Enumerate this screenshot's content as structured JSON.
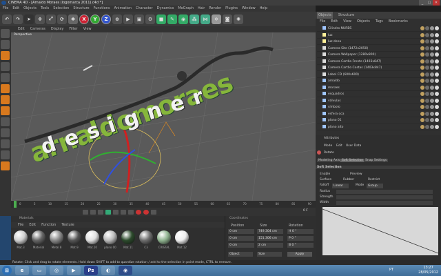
{
  "window": {
    "title": "CINEMA 4D - [Arnaldo Moraes (logomarca 2011).c4d *]",
    "buttons": [
      "_",
      "▢",
      "✕"
    ]
  },
  "menubar": [
    "File",
    "Edit",
    "Objects",
    "Tools",
    "Selection",
    "Structure",
    "Functions",
    "Animation",
    "Character",
    "Dynamics",
    "MoGraph",
    "Hair",
    "Render",
    "Plugins",
    "Window",
    "Help"
  ],
  "toolbar": {
    "axis_labels": [
      "X",
      "Y",
      "Z"
    ]
  },
  "viewport": {
    "menu": [
      "Edit",
      "Cameras",
      "Display",
      "Filter",
      "View"
    ],
    "label": "Perspective",
    "logo_main": "arnaldomoraes",
    "logo_sub": "designer"
  },
  "objects_panel": {
    "tabs": [
      "Objects",
      "Structure"
    ],
    "menu": [
      "File",
      "Edit",
      "View",
      "Objects",
      "Tags",
      "Bookmarks"
    ],
    "items": [
      {
        "name": "Cilindro NURBS",
        "color": "#9fc5ff"
      },
      {
        "name": "luz",
        "color": "#fff199"
      },
      {
        "name": "luz dena",
        "color": "#fff199"
      },
      {
        "name": "Camera Site (1472x2050)",
        "color": "#dddddd"
      },
      {
        "name": "Camera Wallpaper (1280x800)",
        "color": "#dddddd"
      },
      {
        "name": "Camera Cartão Frente (1403x847)",
        "color": "#dddddd"
      },
      {
        "name": "Camera Cartão Costas (1403x847)",
        "color": "#dddddd"
      },
      {
        "name": "Label CD (600x600)",
        "color": "#dddddd"
      },
      {
        "name": "arnaldo",
        "color": "#9fc5ff"
      },
      {
        "name": "moraes",
        "color": "#9fc5ff"
      },
      {
        "name": "esquadros",
        "color": "#9fc5ff"
      },
      {
        "name": "válvulas",
        "color": "#9fc5ff"
      },
      {
        "name": "símbolo",
        "color": "#9fc5ff"
      },
      {
        "name": "esfera oca",
        "color": "#9fc5ff"
      },
      {
        "name": "plano 01",
        "color": "#9fc5ff"
      },
      {
        "name": "plano alto",
        "color": "#9fc5ff"
      }
    ]
  },
  "attributes_panel": {
    "title": "Attributes",
    "menu": [
      "Mode",
      "Edit",
      "User Data"
    ],
    "tool_name": "Rotate",
    "tabs": [
      "Modeling Axis",
      "Soft Selection",
      "Snap Settings"
    ],
    "section": "Soft Selection",
    "options": {
      "enable": "Enable",
      "preview": "Preview",
      "surface": "Surface",
      "rubber": "Rubber",
      "restrict": "Restrict",
      "falloff_label": "Falloff",
      "falloff_value": "Linear",
      "mode_label": "Mode",
      "mode_value": "Group",
      "radius": "Radius",
      "strength": "Strength",
      "width": "Width"
    }
  },
  "timeline": {
    "ticks": [
      "0",
      "5",
      "10",
      "15",
      "20",
      "25",
      "30",
      "35",
      "40",
      "45",
      "50",
      "55",
      "60",
      "65",
      "70",
      "75",
      "80",
      "85",
      "90"
    ],
    "current_frame": "0 F"
  },
  "materials_panel": {
    "title": "Materials",
    "menu": [
      "File",
      "Edit",
      "Function",
      "Texture"
    ],
    "materials": [
      {
        "name": "Mat.3",
        "color": "#d0d0d0"
      },
      {
        "name": "Material",
        "color": "#666666"
      },
      {
        "name": "Metal 8",
        "color": "#888888"
      },
      {
        "name": "Mat.9",
        "color": "#555555"
      },
      {
        "name": "Mat.10",
        "color": "#e0e0e0"
      },
      {
        "name": "plano 00",
        "color": "#bbbbbb"
      },
      {
        "name": "Mat.11",
        "color": "#2c4a2c"
      },
      {
        "name": "C3",
        "color": "#6d6d6d"
      },
      {
        "name": "CRISTAL",
        "color": "#8fb38f"
      },
      {
        "name": "Mat.12",
        "color": "#eeeeee"
      }
    ]
  },
  "coordinates_panel": {
    "title": "Coordinates",
    "headers": [
      "Position",
      "Size",
      "Rotation"
    ],
    "rows": [
      {
        "axis": "X",
        "pos": "0 cm",
        "size": "749.304 cm",
        "rot": "H 0 °"
      },
      {
        "axis": "Y",
        "pos": "0 cm",
        "size": "151.306 cm",
        "rot": "P 0 °"
      },
      {
        "axis": "Z",
        "pos": "0 cm",
        "size": "2 cm",
        "rot": "B 0 °"
      }
    ],
    "mode_object": "Object",
    "mode_size": "Size",
    "apply": "Apply"
  },
  "statusbar": "Rotate: Click and drag to rotate elements. Hold down SHIFT to add to quantize rotation / add to the selection in point mode, CTRL to remove.",
  "taskbar": {
    "language": "PT",
    "time": "13:27",
    "date": "28/05/2012"
  },
  "colors": {
    "accent_orange": "#d8791e",
    "viewport_bg": "#5a5a5a",
    "logo_green": "#86b63b"
  }
}
